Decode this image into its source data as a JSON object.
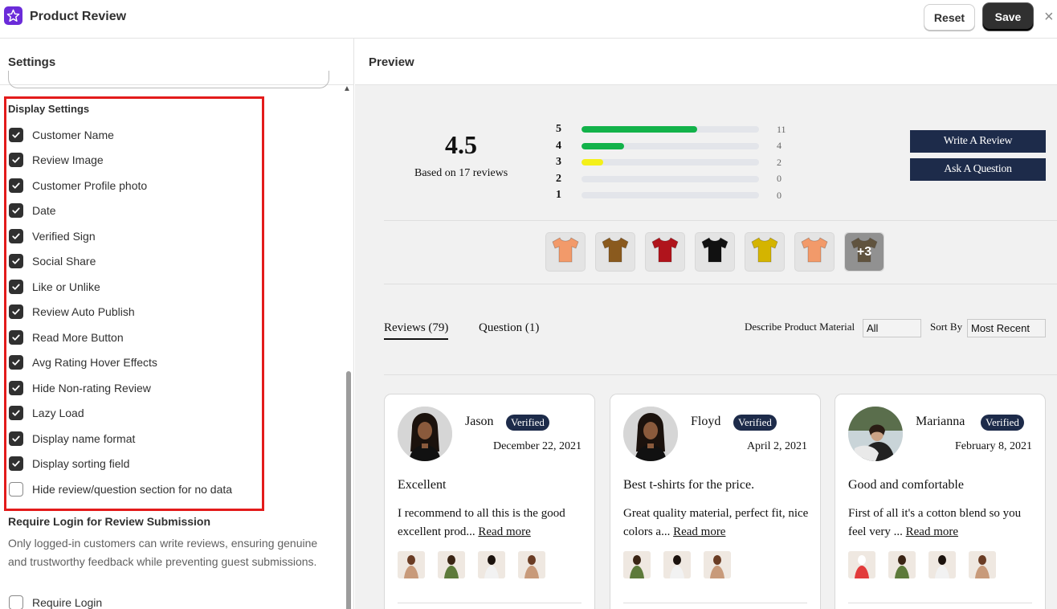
{
  "app": {
    "title": "Product Review"
  },
  "toolbar": {
    "reset_label": "Reset",
    "save_label": "Save",
    "close_glyph": "×"
  },
  "settings": {
    "header": "Settings",
    "display_settings_title": "Display Settings",
    "options": [
      {
        "label": "Customer Name",
        "checked": true
      },
      {
        "label": "Review Image",
        "checked": true
      },
      {
        "label": "Customer Profile photo",
        "checked": true
      },
      {
        "label": "Date",
        "checked": true
      },
      {
        "label": "Verified Sign",
        "checked": true
      },
      {
        "label": "Social Share",
        "checked": true
      },
      {
        "label": "Like or Unlike",
        "checked": true
      },
      {
        "label": "Review Auto Publish",
        "checked": true
      },
      {
        "label": "Read More Button",
        "checked": true
      },
      {
        "label": "Avg Rating Hover Effects",
        "checked": true
      },
      {
        "label": "Hide Non-rating Review",
        "checked": true
      },
      {
        "label": "Lazy Load",
        "checked": true
      },
      {
        "label": "Display name format",
        "checked": true
      },
      {
        "label": "Display sorting field",
        "checked": true
      },
      {
        "label": "Hide review/question section for no data",
        "checked": false
      }
    ],
    "require_login": {
      "title": "Require Login for Review Submission",
      "description": "Only logged-in customers can write reviews, ensuring genuine and trustworthy feedback while preventing guest submissions.",
      "checkbox_label": "Require Login",
      "checked": false
    }
  },
  "preview": {
    "header": "Preview",
    "average": "4.5",
    "based_on": "Based on 17 reviews",
    "distribution": [
      {
        "star": "5",
        "count": "11",
        "fraction": 0.65,
        "color": "#12b24a"
      },
      {
        "star": "4",
        "count": "4",
        "fraction": 0.24,
        "color": "#12b24a"
      },
      {
        "star": "3",
        "count": "2",
        "fraction": 0.12,
        "color": "#f4f019"
      },
      {
        "star": "2",
        "count": "0",
        "fraction": 0,
        "color": "#12b24a"
      },
      {
        "star": "1",
        "count": "0",
        "fraction": 0,
        "color": "#12b24a"
      }
    ],
    "write_review_label": "Write A Review",
    "ask_question_label": "Ask A Question",
    "thumbnails": [
      {
        "icon": "tshirt-icon",
        "color": "#f29a6a"
      },
      {
        "icon": "tshirt-icon",
        "color": "#8a5a1e"
      },
      {
        "icon": "tshirt-icon",
        "color": "#b0141c"
      },
      {
        "icon": "tshirt-icon",
        "color": "#111111"
      },
      {
        "icon": "tshirt-icon",
        "color": "#d4b400"
      },
      {
        "icon": "tshirt-icon",
        "color": "#f29a6a"
      },
      {
        "icon": "tshirt-icon",
        "color": "#6a4a16",
        "overlay": "+3"
      }
    ],
    "tabs": {
      "reviews": "Reviews (79)",
      "question": "Question (1)"
    },
    "filter": {
      "label": "Describe Product Material",
      "value": "All"
    },
    "sort": {
      "label": "Sort By",
      "value": "Most Recent"
    },
    "verified_label": "Verified",
    "reviews": [
      {
        "name": "Jason",
        "date": "December 22, 2021",
        "title": "Excellent",
        "body": "I recommend to all this is the good excellent prod...",
        "read_more": "Read more"
      },
      {
        "name": "Floyd",
        "date": "April 2, 2021",
        "title": "Best t-shirts for the price.",
        "body": "Great quality material, perfect fit, nice colors a...",
        "read_more": "Read more"
      },
      {
        "name": "Marianna",
        "date": "February 8, 2021",
        "title": "Good and comfortable",
        "body": "First of all it's a cotton blend so you feel very ...",
        "read_more": "Read more"
      }
    ]
  }
}
